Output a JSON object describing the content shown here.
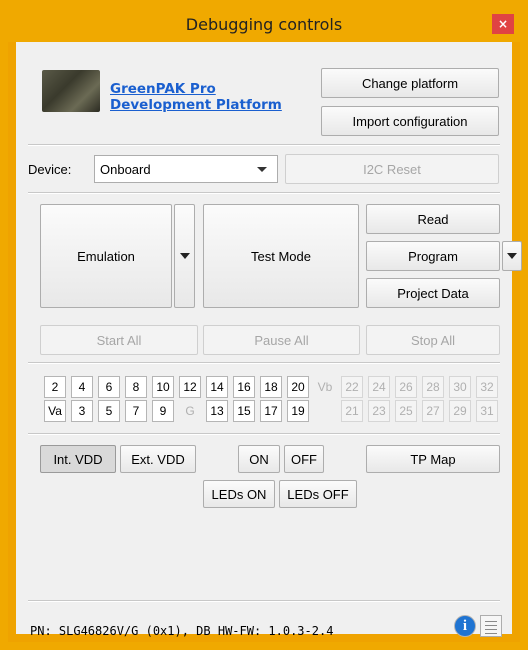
{
  "window": {
    "title": "Debugging controls",
    "close_glyph": "×"
  },
  "platform": {
    "name_line1": "GreenPAK Pro",
    "name_line2": "Development Platform",
    "change_label": "Change platform",
    "import_label": "Import configuration"
  },
  "device": {
    "label": "Device:",
    "value": "Onboard",
    "i2c_reset": "I2C Reset"
  },
  "controls": {
    "emulation": "Emulation",
    "test_mode": "Test Mode",
    "read": "Read",
    "program": "Program",
    "project_data": "Project Data",
    "start_all": "Start All",
    "pause_all": "Pause All",
    "stop_all": "Stop All"
  },
  "pins": {
    "row1": [
      {
        "label": "2",
        "state": "enabled"
      },
      {
        "label": "4",
        "state": "enabled"
      },
      {
        "label": "6",
        "state": "enabled"
      },
      {
        "label": "8",
        "state": "enabled"
      },
      {
        "label": "10",
        "state": "enabled"
      },
      {
        "label": "12",
        "state": "enabled"
      },
      {
        "label": "14",
        "state": "enabled"
      },
      {
        "label": "16",
        "state": "enabled"
      },
      {
        "label": "18",
        "state": "enabled"
      },
      {
        "label": "20",
        "state": "enabled"
      },
      {
        "label": "Vb",
        "state": "ghost"
      },
      {
        "label": "22",
        "state": "disabled"
      },
      {
        "label": "24",
        "state": "disabled"
      },
      {
        "label": "26",
        "state": "disabled"
      },
      {
        "label": "28",
        "state": "disabled"
      },
      {
        "label": "30",
        "state": "disabled"
      },
      {
        "label": "32",
        "state": "disabled"
      }
    ],
    "row2": [
      {
        "label": "Va",
        "state": "enabled"
      },
      {
        "label": "3",
        "state": "enabled"
      },
      {
        "label": "5",
        "state": "enabled"
      },
      {
        "label": "7",
        "state": "enabled"
      },
      {
        "label": "9",
        "state": "enabled"
      },
      {
        "label": "G",
        "state": "ghost"
      },
      {
        "label": "13",
        "state": "enabled"
      },
      {
        "label": "15",
        "state": "enabled"
      },
      {
        "label": "17",
        "state": "enabled"
      },
      {
        "label": "19",
        "state": "enabled"
      },
      {
        "label": "",
        "state": "ghost"
      },
      {
        "label": "21",
        "state": "disabled"
      },
      {
        "label": "23",
        "state": "disabled"
      },
      {
        "label": "25",
        "state": "disabled"
      },
      {
        "label": "27",
        "state": "disabled"
      },
      {
        "label": "29",
        "state": "disabled"
      },
      {
        "label": "31",
        "state": "disabled"
      }
    ]
  },
  "power": {
    "int_vdd": "Int. VDD",
    "ext_vdd": "Ext. VDD",
    "on": "ON",
    "off": "OFF",
    "tp_map": "TP Map",
    "leds_on": "LEDs ON",
    "leds_off": "LEDs OFF"
  },
  "status": {
    "text": "PN: SLG46826V/G (0x1), DB HW-FW: 1.0.3-2.4"
  },
  "icons": {
    "info": "info-icon",
    "log": "log-icon"
  },
  "colors": {
    "accent": "#f0a900",
    "link": "#1a5fcf",
    "close": "#e04343",
    "info": "#1f74d2"
  }
}
